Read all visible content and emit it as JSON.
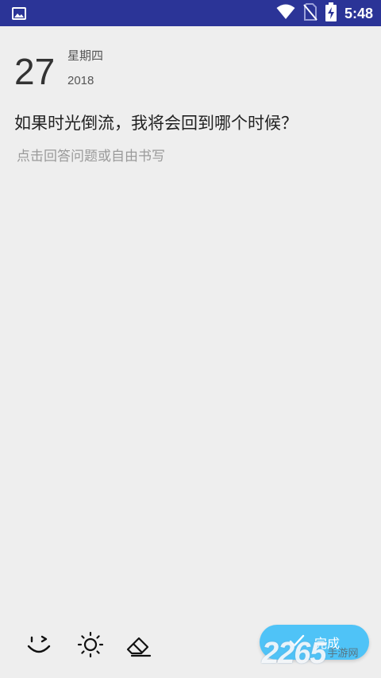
{
  "status_bar": {
    "time": "5:48",
    "icons": [
      "image-icon",
      "wifi-icon",
      "no-sim-icon",
      "battery-charging-icon"
    ]
  },
  "date": {
    "day": "27",
    "weekday": "星期四",
    "year": "2018"
  },
  "entry": {
    "question": "如果时光倒流，我将会回到哪个时候？",
    "answer_placeholder": "点击回答问题或自由书写"
  },
  "toolbar": {
    "icons": [
      "mood-icon",
      "weather-icon",
      "eraser-icon"
    ],
    "done_label": "完成"
  },
  "watermark": {
    "digits": "2265",
    "text": "手游网"
  },
  "colors": {
    "status_bar": "#2b3497",
    "background": "#eeeeee",
    "accent": "#4fc3f7"
  }
}
